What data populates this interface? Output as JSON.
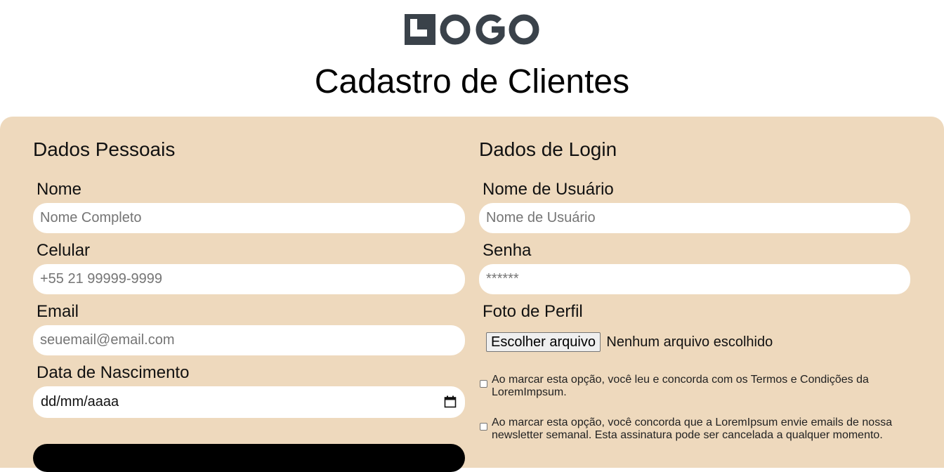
{
  "header": {
    "logo_text": "LOGO",
    "title": "Cadastro de Clientes"
  },
  "personal": {
    "section_title": "Dados Pessoais",
    "name_label": "Nome",
    "name_placeholder": "Nome Completo",
    "phone_label": "Celular",
    "phone_placeholder": "+55 21 99999-9999",
    "email_label": "Email",
    "email_placeholder": "seuemail@email.com",
    "birth_label": "Data de Nascimento",
    "birth_value": "dd/mm/aaaa"
  },
  "login": {
    "section_title": "Dados de Login",
    "username_label": "Nome de Usuário",
    "username_placeholder": "Nome de Usuário",
    "password_label": "Senha",
    "password_placeholder": "******",
    "photo_label": "Foto de Perfil",
    "file_button_label": "Escolher arquivo",
    "file_status": "Nenhum arquivo escolhido",
    "terms_text": "Ao marcar esta opção, você leu e concorda com os Termos e Condições da LoremImpsum.",
    "terms_checked": false,
    "newsletter_text": "Ao marcar esta opção, você concorda que a LoremIpsum envie emails de nossa newsletter semanal. Esta assinatura pode ser cancelada a qualquer momento.",
    "newsletter_checked": false
  },
  "colors": {
    "panel": "#eed9bd",
    "logo": "#3a424a",
    "input_bg": "#ffffff"
  },
  "icons": {
    "calendar": "calendar-icon",
    "logo_mark": "logo-mark-icon"
  }
}
